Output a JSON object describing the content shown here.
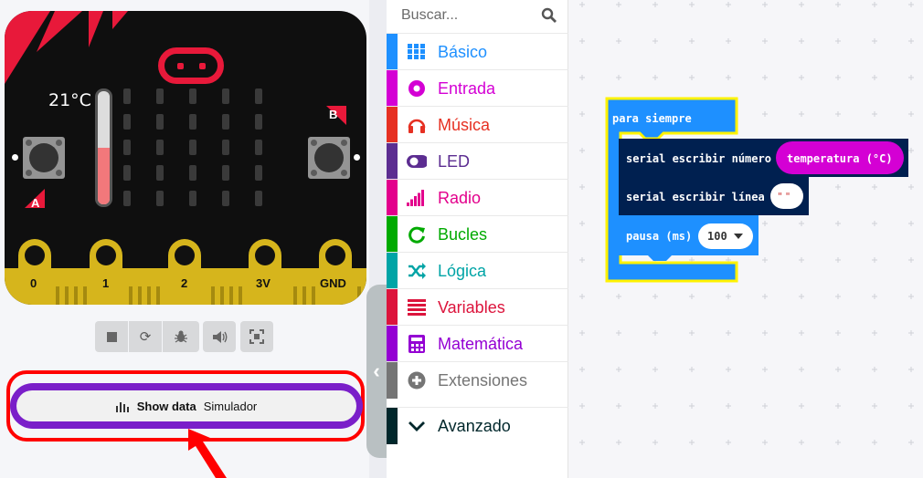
{
  "simulator": {
    "temperature_label": "21°C",
    "temperature_level": 0.5,
    "button_a": "A",
    "button_b": "B",
    "pins": [
      "0",
      "1",
      "2",
      "3V",
      "GND"
    ],
    "controls": [
      "stop-icon",
      "restart-icon",
      "debug-icon",
      "sound-icon",
      "fullscreen-icon"
    ],
    "show_data_label": "Show data",
    "show_data_sub": "Simulador",
    "collapse_glyph": "‹"
  },
  "toolbox": {
    "search_placeholder": "Buscar...",
    "categories": [
      {
        "label": "Básico",
        "color": "#1e90ff",
        "icon": "grid-icon"
      },
      {
        "label": "Entrada",
        "color": "#d400d4",
        "icon": "record-icon"
      },
      {
        "label": "Música",
        "color": "#e63022",
        "icon": "headphones-icon"
      },
      {
        "label": "LED",
        "color": "#5c2d91",
        "icon": "toggle-icon"
      },
      {
        "label": "Radio",
        "color": "#e3008c",
        "icon": "signal-icon"
      },
      {
        "label": "Bucles",
        "color": "#00aa00",
        "icon": "refresh-icon"
      },
      {
        "label": "Lógica",
        "color": "#00a4a6",
        "icon": "shuffle-icon"
      },
      {
        "label": "Variables",
        "color": "#dc143c",
        "icon": "list-icon"
      },
      {
        "label": "Matemática",
        "color": "#9400d3",
        "icon": "calculator-icon"
      },
      {
        "label": "Extensiones",
        "color": "#757575",
        "icon": "plus-icon"
      },
      {
        "label": "Avanzado",
        "color": "#00272b",
        "icon": "chevron-down-icon"
      }
    ]
  },
  "workspace": {
    "forever_label": "para siempre",
    "serial_number_label": "serial escribir número",
    "temperature_reporter": "temperatura (°C)",
    "serial_line_label": "serial escribir línea",
    "string_value": "\" \"",
    "pause_label": "pausa (ms)",
    "pause_value": "100"
  }
}
